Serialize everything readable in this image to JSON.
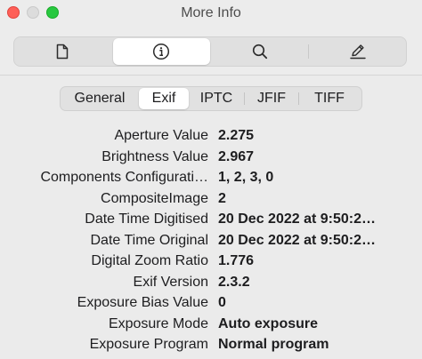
{
  "window": {
    "title": "More Info"
  },
  "toolbar": {
    "items": [
      {
        "name": "document",
        "icon": "document-icon"
      },
      {
        "name": "info",
        "icon": "info-icon",
        "active": true
      },
      {
        "name": "search",
        "icon": "search-icon"
      },
      {
        "name": "edit",
        "icon": "pencil-icon"
      }
    ]
  },
  "tabs": [
    {
      "label": "General"
    },
    {
      "label": "Exif",
      "active": true
    },
    {
      "label": "IPTC"
    },
    {
      "label": "JFIF"
    },
    {
      "label": "TIFF"
    }
  ],
  "properties": [
    {
      "label": "Aperture Value",
      "value": "2.275"
    },
    {
      "label": "Brightness Value",
      "value": "2.967"
    },
    {
      "label": "Components Configurati…",
      "value": "1, 2, 3, 0"
    },
    {
      "label": "CompositeImage",
      "value": "2"
    },
    {
      "label": "Date Time Digitised",
      "value": "20 Dec 2022 at 9:50:2…"
    },
    {
      "label": "Date Time Original",
      "value": "20 Dec 2022 at 9:50:2…"
    },
    {
      "label": "Digital Zoom Ratio",
      "value": "1.776"
    },
    {
      "label": "Exif Version",
      "value": "2.3.2"
    },
    {
      "label": "Exposure Bias Value",
      "value": "0"
    },
    {
      "label": "Exposure Mode",
      "value": "Auto exposure"
    },
    {
      "label": "Exposure Program",
      "value": "Normal program"
    }
  ],
  "colors": {
    "close": "#fe5f57",
    "minimize": "#dcdcdc",
    "maximize": "#28c840"
  }
}
